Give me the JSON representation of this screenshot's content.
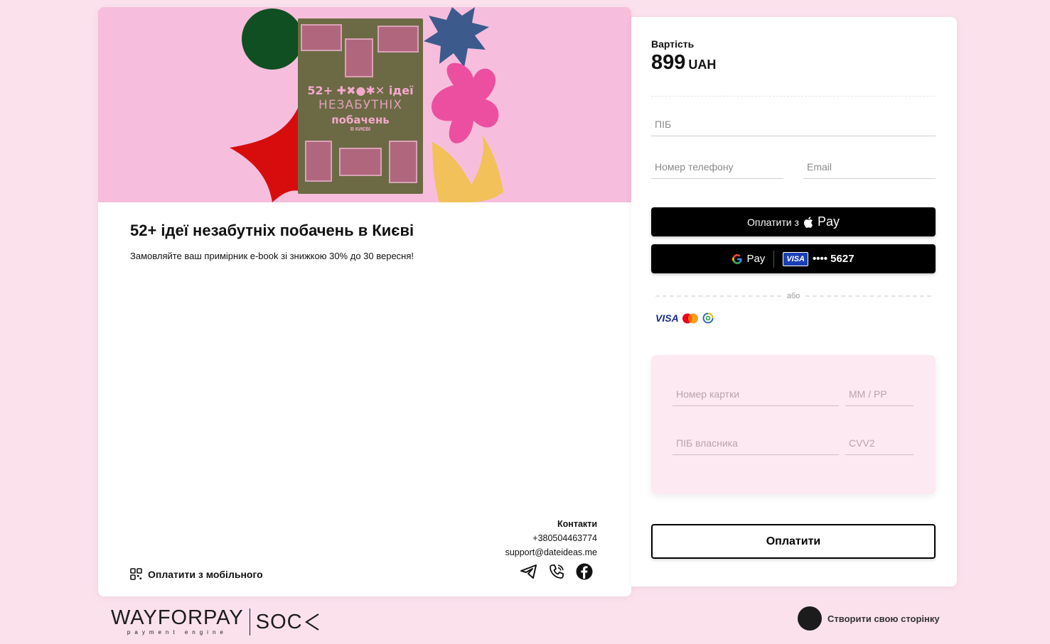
{
  "product": {
    "book_cover": {
      "line1": "52+ ✚✖●✱✕ ідеї",
      "line2": "НЕЗАБУТНІХ",
      "line3": "побачень",
      "line4": "В КИЄВІ"
    },
    "title": "52+ ідеї незабутніх побачень в Києві",
    "description": "Замовляйте ваш примірник e-book зі знижкою 30% до 30 вересня!"
  },
  "contacts": {
    "heading": "Контакти",
    "phone": "+380504463774",
    "email": "support@dateideas.me",
    "socials": [
      "telegram-icon",
      "phone-icon",
      "facebook-icon"
    ]
  },
  "mobile_pay": {
    "label": "Оплатити з мобільного"
  },
  "checkout": {
    "price_label": "Вартість",
    "price_amount": "899",
    "currency": "UAH",
    "fields": {
      "name_placeholder": "ПІБ",
      "phone_placeholder": "Номер телефону",
      "email_placeholder": "Email"
    },
    "apple_pay": {
      "prefix": "Оплатити з",
      "suffix": "Pay"
    },
    "google_pay": {
      "label": "Pay",
      "card_brand": "VISA",
      "card_mask": "•••• 5627"
    },
    "or_label": "або",
    "card_logos": {
      "visa": "VISA"
    },
    "card_form": {
      "card_number_placeholder": "Номер картки",
      "expiry_placeholder": "MM / РР",
      "holder_placeholder": "ПІБ власника",
      "cvv_placeholder": "CVV2"
    },
    "submit_label": "Оплатити"
  },
  "footer": {
    "brand": "WAYFORPAY",
    "brand_sub": "payment engine",
    "partner": "SOC",
    "create_page_label": "Створити свою сторінку"
  },
  "colors": {
    "page_bg": "#fbe1ec",
    "hero_bg": "#f6bedc",
    "book_bg": "#6b6a44",
    "card_form_bg": "#fde9f2",
    "accent_black": "#000000"
  }
}
